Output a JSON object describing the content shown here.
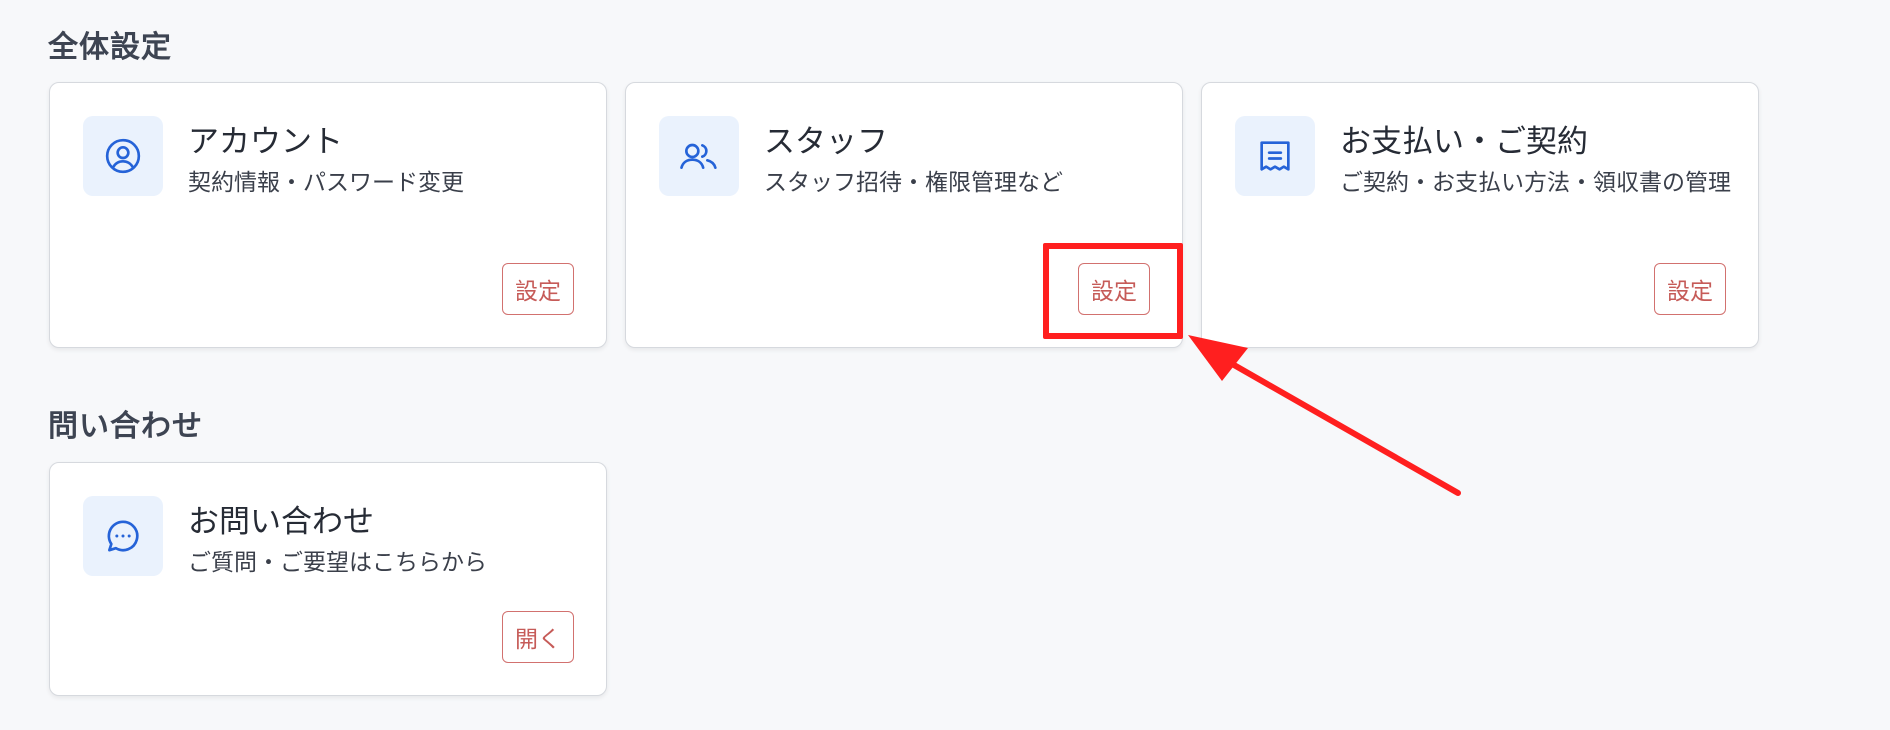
{
  "sections": [
    {
      "title": "全体設定"
    },
    {
      "title": "問い合わせ"
    }
  ],
  "cards": [
    {
      "title": "アカウント",
      "description": "契約情報・パスワード変更",
      "button": "設定",
      "icon": "user-circle-icon"
    },
    {
      "title": "スタッフ",
      "description": "スタッフ招待・権限管理など",
      "button": "設定",
      "icon": "users-icon"
    },
    {
      "title": "お支払い・ご契約",
      "description": "ご契約・お支払い方法・領収書の管理",
      "button": "設定",
      "icon": "receipt-icon"
    },
    {
      "title": "お問い合わせ",
      "description": "ご質問・ご要望はこちらから",
      "button": "開く",
      "icon": "chat-bubble-icon"
    }
  ],
  "colors": {
    "icon_blue": "#2563d8",
    "button_red": "#c65b58",
    "annotation_red": "#ff1f1f"
  }
}
